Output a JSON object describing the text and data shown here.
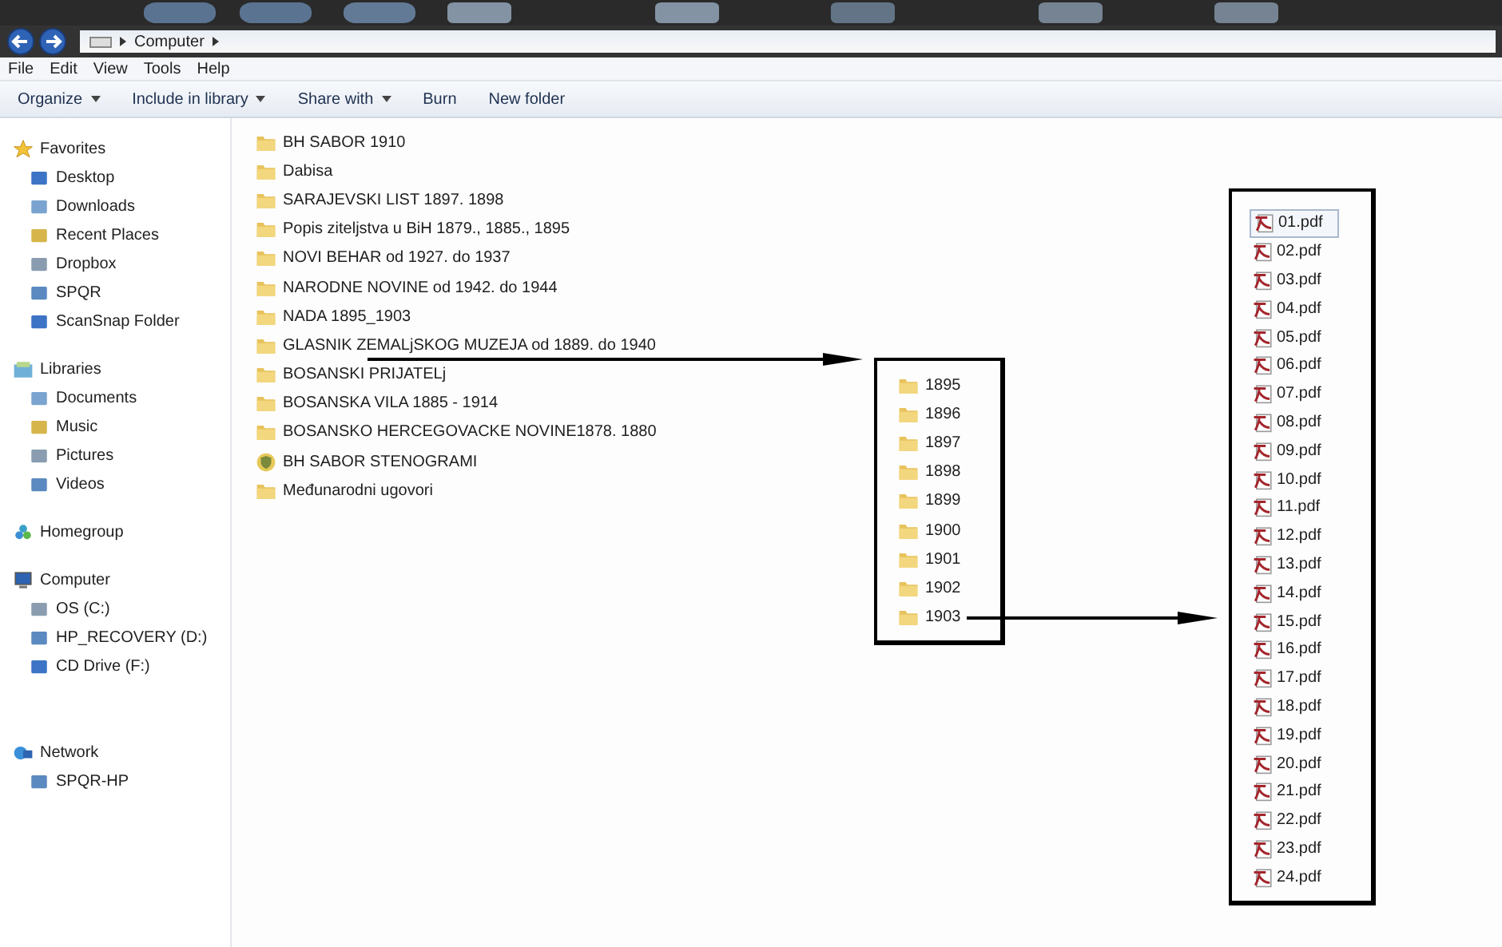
{
  "address_bar": {
    "breadcrumbs": [
      "Computer"
    ]
  },
  "menu_bar": [
    "File",
    "Edit",
    "View",
    "Tools",
    "Help"
  ],
  "toolbar": [
    {
      "label": "Organize",
      "dropdown": true
    },
    {
      "label": "Include in library",
      "dropdown": true
    },
    {
      "label": "Share with",
      "dropdown": true
    },
    {
      "label": "Burn",
      "dropdown": false
    },
    {
      "label": "New folder",
      "dropdown": false
    }
  ],
  "sidebar": {
    "groups": [
      {
        "label": "Favorites",
        "items": [
          "Desktop",
          "Downloads",
          "Recent Places",
          "Dropbox",
          "SPQR",
          "ScanSnap Folder"
        ]
      },
      {
        "label": "Libraries",
        "items": [
          "Documents",
          "Music",
          "Pictures",
          "Videos"
        ]
      },
      {
        "label": "Homegroup"
      },
      {
        "label": "Computer",
        "items": [
          "OS (C:)",
          "HP_RECOVERY (D:)",
          "CD Drive (F:)"
        ]
      },
      {
        "label": "Network",
        "items": [
          "SPQR-HP"
        ]
      }
    ]
  },
  "folders": [
    {
      "name": "BH SABOR 1910",
      "kind": "folder"
    },
    {
      "name": "Dabisa",
      "kind": "folder"
    },
    {
      "name": "SARAJEVSKI LIST 1897. 1898",
      "kind": "folder"
    },
    {
      "name": "Popis ziteljstva u BiH 1879., 1885., 1895",
      "kind": "folder"
    },
    {
      "name": "NOVI BEHAR od 1927. do 1937",
      "kind": "folder"
    },
    {
      "name": "NARODNE NOVINE od 1942. do 1944",
      "kind": "folder"
    },
    {
      "name": "NADA 1895_1903",
      "kind": "folder"
    },
    {
      "name": "GLASNIK ZEMALjSKOG MUZEJA od 1889. do 1940",
      "kind": "folder"
    },
    {
      "name": "BOSANSKI PRIJATELj",
      "kind": "folder"
    },
    {
      "name": "BOSANSKA VILA 1885 - 1914",
      "kind": "folder"
    },
    {
      "name": "BOSANSKO HERCEGOVACKE NOVINE1878. 1880",
      "kind": "folder"
    },
    {
      "name": "BH SABOR STENOGRAMI",
      "kind": "shield"
    },
    {
      "name": "Međunarodni ugovori",
      "kind": "folder"
    }
  ],
  "subfolders": [
    "1895",
    "1896",
    "1897",
    "1898",
    "1899",
    "1900",
    "1901",
    "1902",
    "1903"
  ],
  "files": [
    {
      "name": "01.pdf",
      "selected": true
    },
    {
      "name": "02.pdf",
      "selected": false
    },
    {
      "name": "03.pdf",
      "selected": false
    },
    {
      "name": "04.pdf",
      "selected": false
    },
    {
      "name": "05.pdf",
      "selected": false
    },
    {
      "name": "06.pdf",
      "selected": false
    },
    {
      "name": "07.pdf",
      "selected": false
    },
    {
      "name": "08.pdf",
      "selected": false
    },
    {
      "name": "09.pdf",
      "selected": false
    },
    {
      "name": "10.pdf",
      "selected": false
    },
    {
      "name": "11.pdf",
      "selected": false
    },
    {
      "name": "12.pdf",
      "selected": false
    },
    {
      "name": "13.pdf",
      "selected": false
    },
    {
      "name": "14.pdf",
      "selected": false
    },
    {
      "name": "15.pdf",
      "selected": false
    },
    {
      "name": "16.pdf",
      "selected": false
    },
    {
      "name": "17.pdf",
      "selected": false
    },
    {
      "name": "18.pdf",
      "selected": false
    },
    {
      "name": "19.pdf",
      "selected": false
    },
    {
      "name": "20.pdf",
      "selected": false
    },
    {
      "name": "21.pdf",
      "selected": false
    },
    {
      "name": "22.pdf",
      "selected": false
    },
    {
      "name": "23.pdf",
      "selected": false
    },
    {
      "name": "24.pdf",
      "selected": false
    }
  ]
}
